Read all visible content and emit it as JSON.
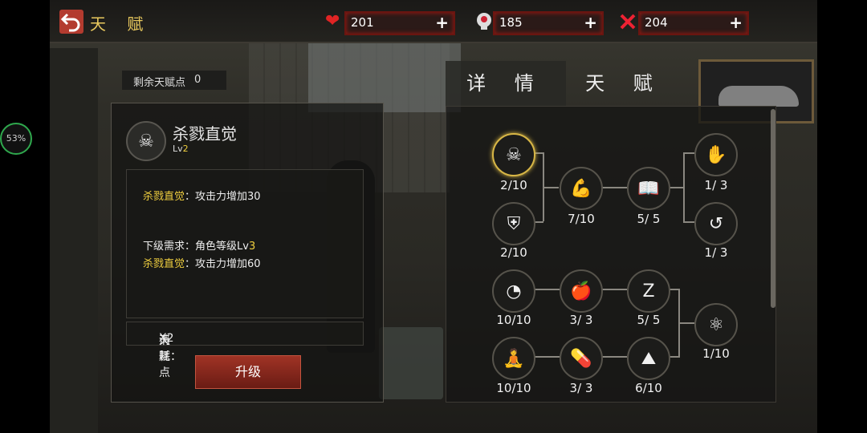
{
  "header": {
    "title": "天 赋",
    "resources": [
      {
        "name": "health",
        "value": "201"
      },
      {
        "name": "food",
        "value": "185"
      },
      {
        "name": "energy",
        "value": "204"
      }
    ],
    "plus_label": "+"
  },
  "left": {
    "points_label": "剩余天赋点",
    "points_value": "0",
    "skill": {
      "name": "杀戮直觉",
      "level_prefix": "Lv",
      "level_value": "2"
    },
    "desc": {
      "line1_name": "杀戮直觉",
      "line1_effect": "：攻击力增加30",
      "req_label": "下级需求：角色等级Lv",
      "req_value": "3",
      "line2_name": "杀戮直觉",
      "line2_effect": "：攻击力增加60"
    },
    "cost": {
      "label": "消耗：",
      "item": "天赋点",
      "mult": "X2"
    },
    "upgrade_button": "升级"
  },
  "tabs": [
    {
      "label": "详 情"
    },
    {
      "label": "天 赋"
    }
  ],
  "tree": {
    "nodes": [
      {
        "icon": "skull-crossbones-icon",
        "glyph": "☠",
        "count": "2/10"
      },
      {
        "icon": "shield-icon",
        "glyph": "⛨",
        "count": "2/10"
      },
      {
        "icon": "muscle-icon",
        "glyph": "💪",
        "count": "7/10"
      },
      {
        "icon": "book-icon",
        "glyph": "📖",
        "count": "5/ 5"
      },
      {
        "icon": "claw-icon",
        "glyph": "✋",
        "count": "1/ 3"
      },
      {
        "icon": "dodge-icon",
        "glyph": "↺",
        "count": "1/ 3"
      },
      {
        "icon": "stomach-icon",
        "glyph": "◔",
        "count": "10/10"
      },
      {
        "icon": "apple-icon",
        "glyph": "🍎",
        "count": "3/ 3"
      },
      {
        "icon": "sleep-icon",
        "glyph": "Z",
        "count": "5/ 5"
      },
      {
        "icon": "molecule-icon",
        "glyph": "⚛",
        "count": "1/10"
      },
      {
        "icon": "meditate-icon",
        "glyph": "🧘",
        "count": "10/10"
      },
      {
        "icon": "pill-icon",
        "glyph": "💊",
        "count": "3/ 3"
      },
      {
        "icon": "rock-icon",
        "glyph": "⛰",
        "count": "6/10"
      }
    ]
  },
  "overlay": {
    "progress": "53%"
  }
}
